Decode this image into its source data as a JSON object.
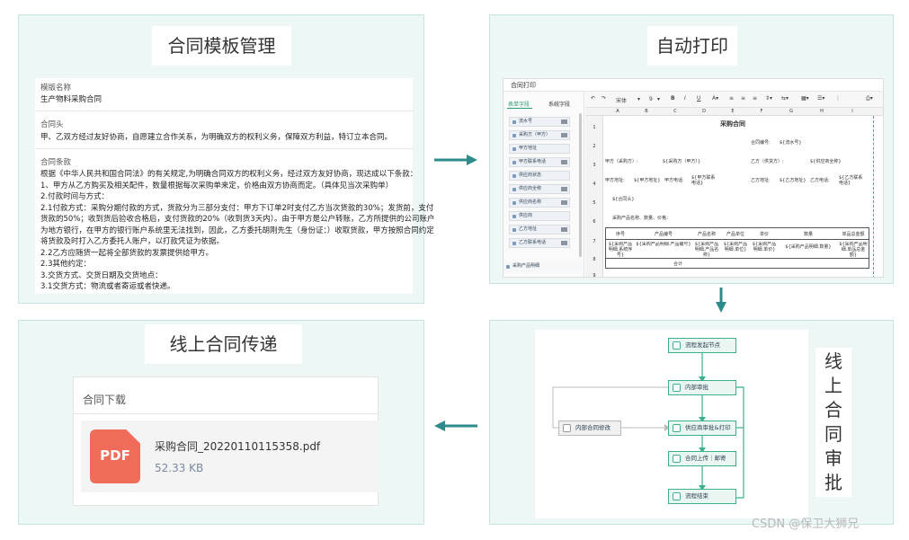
{
  "panels": {
    "template": {
      "title": "合同模板管理"
    },
    "print": {
      "title": "自动打印"
    },
    "approve": {
      "title_chars": [
        "线",
        "上",
        "合",
        "同",
        "审",
        "批"
      ]
    },
    "deliver": {
      "title": "线上合同传递"
    }
  },
  "template_form": {
    "name_label": "模版名称",
    "name_value": "生产物料采购合同",
    "head_label": "合同头",
    "head_value": "甲、乙双方经过友好协商，自愿建立合作关系，为明确双方的权利义务，保障双方利益，特订立本合同。",
    "terms_label": "合同条款",
    "terms_lines": [
      "根据《中华人民共和国合同法》的有关规定,为明确合同双方的权利义务，经过双方友好协商，现达成以下条款：",
      "1、甲方从乙方购买及相关配件，数量根据每次采购单来定，价格由双方协商而定。（具体见当次采购单）",
      "2.付款时间与方式：",
      "2.1付款方式：采购分期付款的方式，货款分为三部分支付：甲方下订单2时支付乙方当次货款的30%；发货前，支付",
      "货款的50%；收到货后验收合格后，支付货款的20%（收到货3天内）。由于甲方是公户转账，乙方所提供的公司账户",
      "为地方银行，在甲方的银行账户系统里无法找到，因此，乙方委托胡刚先生（身份证：）收取货款，甲方按照合同约定",
      "将货款及时打入乙方委托人账户，以打款凭证为依据。",
      "2.2乙方应随货一起将全部货款的发票提供给甲方。",
      "2.3其他约定：",
      "3.交货方式、交货日期及交货地点：",
      "3.1交货方式：物流或者寄运或者快递。"
    ]
  },
  "print_ui": {
    "window_title": "合同打印",
    "tabs": [
      "表单字段",
      "系统字段"
    ],
    "fields": [
      "流水号",
      "采购方（甲方）",
      "甲方地址",
      "甲方联系电话",
      "供应商状态",
      "供应商全称",
      "供应商名称",
      "供应商",
      "乙方地址",
      "乙方联系电话"
    ],
    "bottom_field": "采购产品明细",
    "toolbar": {
      "font": "宋体",
      "size": "9",
      "bold": "B",
      "italic": "I",
      "underline": "U"
    },
    "columns": [
      "A",
      "B",
      "C",
      "D",
      "E",
      "F",
      "G",
      "H",
      "I"
    ],
    "rows": [
      "1",
      "2",
      "3",
      "4",
      "5",
      "6",
      "7",
      "8",
      "9"
    ],
    "sheet_title": "采购合同",
    "contract_no_label": "合同编号:",
    "contract_no_value": "${流水号}",
    "party_a_label": "甲方（采购方）:",
    "party_a_value": "${采购方（甲方）}",
    "party_b_label": "乙方（供货方）:",
    "party_b_value": "${供应商全称}",
    "party_a_addr_label": "甲方地址:",
    "party_a_addr_value": "${甲方地址}",
    "party_a_tel_label": "甲方电话:",
    "party_a_tel_value": "${甲方联系电话}",
    "party_b_addr_label": "乙方地址:",
    "party_b_addr_value": "${乙方地址}",
    "party_b_tel_label": "乙方电话:",
    "party_b_tel_value": "${乙方联系电话}",
    "head_var": "${合同头}",
    "product_line": "采购产品名称、数量、价格：",
    "table_headers": [
      "序号",
      "产品编号",
      "产品名称",
      "产品单位",
      "单价",
      "数量",
      "单品总金额"
    ],
    "table_vars": [
      "${采购产品明细.系统序号}",
      "${采购产品明细.产品编号}",
      "${采购产品明细.产品名称}",
      "${采购产品明细.单位}",
      "${采购产品明细.单价}",
      "${采购产品明细.数量}",
      "${采购产品明细.单品总金额}"
    ],
    "total_label": "合计"
  },
  "download": {
    "header": "合同下载",
    "file_type": "PDF",
    "file_name": "采购合同_20220110115358.pdf",
    "file_size": "52.33 KB"
  },
  "workflow": {
    "nodes": [
      "流程发起节点",
      "内部审批",
      "供应商审批&打印",
      "合同上传｜邮寄",
      "流程结束"
    ],
    "side_node": "内部合同修改"
  },
  "watermark": "CSDN @保卫大狮兄",
  "colors": {
    "panel_bg": "#edf7f6",
    "arrow": "#2e8b8b",
    "node_border": "#3bb08f",
    "pdf": "#f06b5a"
  }
}
